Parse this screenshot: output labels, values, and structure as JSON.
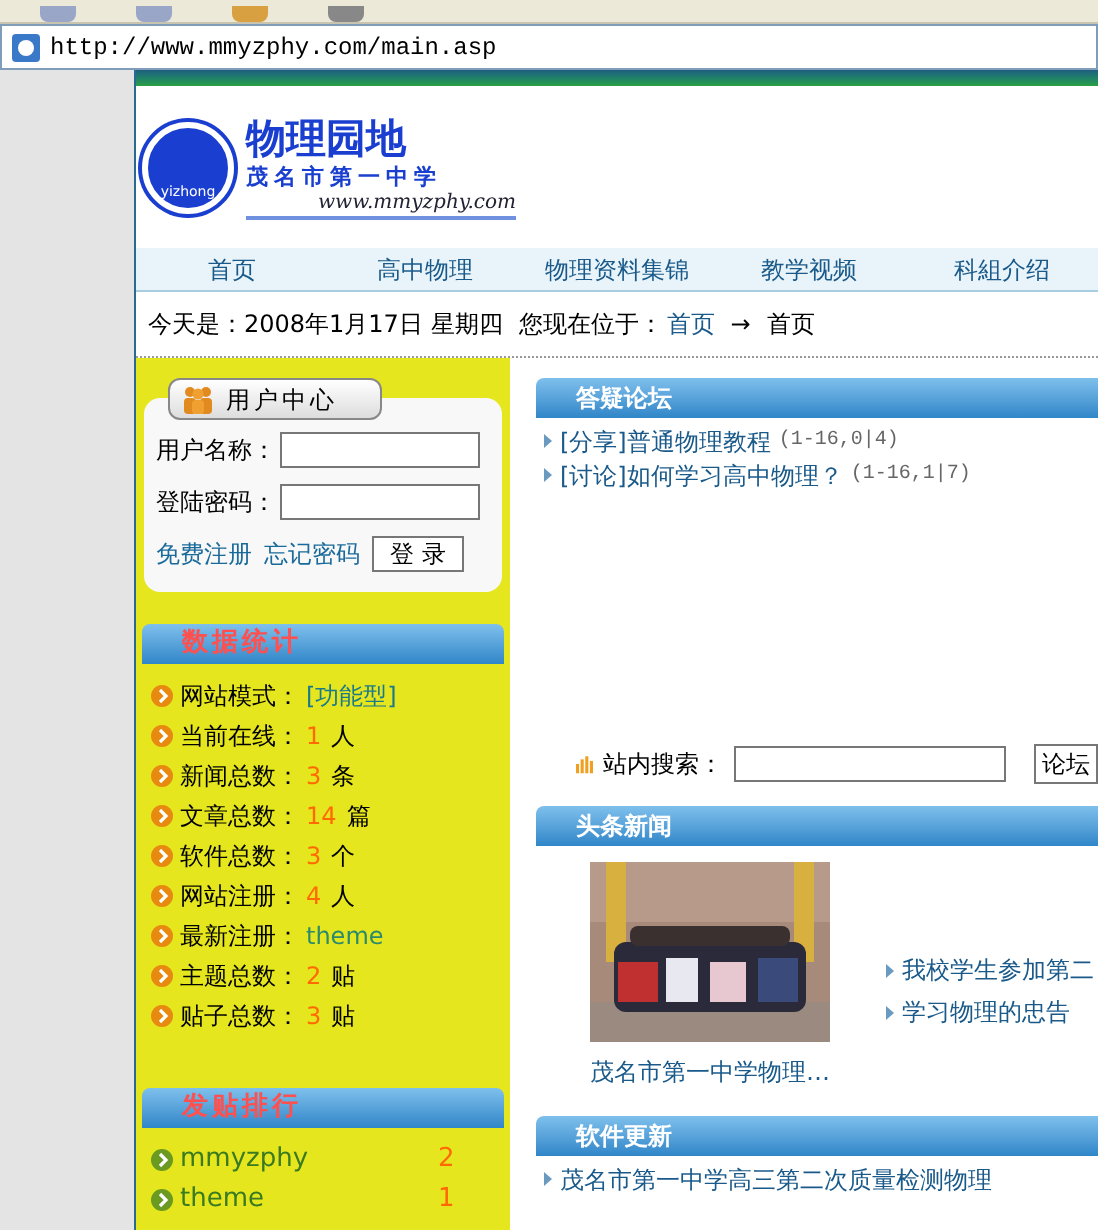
{
  "address_bar": {
    "url": "http://www.mmyzphy.com/main.asp"
  },
  "logo": {
    "badge": "yizhong",
    "title": "物理园地",
    "subtitle": "茂名市第一中学",
    "site": "www.mmyzphy.com"
  },
  "nav": [
    "首页",
    "高中物理",
    "物理资料集锦",
    "教学视频",
    "科組介绍"
  ],
  "date_line": {
    "today": "今天是：2008年1月17日 星期四",
    "location_label": "您现在位于：",
    "crumb_link": "首页",
    "arrow": "→",
    "crumb_current": "首页"
  },
  "user_center": {
    "title": "用户中心",
    "username_label": "用户名称：",
    "password_label": "登陆密码：",
    "register_link": "免费注册",
    "forgot_link": "忘记密码",
    "login_button": "登 录"
  },
  "stats": {
    "title": "数据统计",
    "items": [
      {
        "label": "网站模式：",
        "value": "[功能型]",
        "kind": "link"
      },
      {
        "label": "当前在线：",
        "value": "1",
        "unit": "人",
        "kind": "count"
      },
      {
        "label": "新闻总数：",
        "value": "3",
        "unit": "条",
        "kind": "count"
      },
      {
        "label": "文章总数：",
        "value": "14",
        "unit": "篇",
        "kind": "count"
      },
      {
        "label": "软件总数：",
        "value": "3",
        "unit": "个",
        "kind": "count"
      },
      {
        "label": "网站注册：",
        "value": "4",
        "unit": "人",
        "kind": "count"
      },
      {
        "label": "最新注册：",
        "value": "theme",
        "kind": "user"
      },
      {
        "label": "主题总数：",
        "value": "2",
        "unit": "贴",
        "kind": "count"
      },
      {
        "label": "贴子总数：",
        "value": "3",
        "unit": "贴",
        "kind": "count"
      }
    ]
  },
  "ranking": {
    "title": "发贴排行",
    "items": [
      {
        "name": "mmyzphy",
        "count": "2"
      },
      {
        "name": "theme",
        "count": "1"
      }
    ]
  },
  "forum": {
    "title": "答疑论坛",
    "items": [
      {
        "title": "[分享]普通物理教程",
        "meta": "(1-16,0|4)"
      },
      {
        "title": "[讨论]如何学习高中物理？",
        "meta": "(1-16,1|7)"
      }
    ]
  },
  "search": {
    "label": "站内搜索：",
    "button": "论坛"
  },
  "headlines": {
    "title": "头条新闻",
    "photo": {
      "kind": "picture",
      "caption": "茂名市第一中学物理…"
    },
    "items": [
      "我校学生参加第二",
      "学习物理的忠告"
    ]
  },
  "software": {
    "title": "软件更新",
    "items": [
      "茂名市第一中学高三第二次质量检测物理"
    ]
  }
}
